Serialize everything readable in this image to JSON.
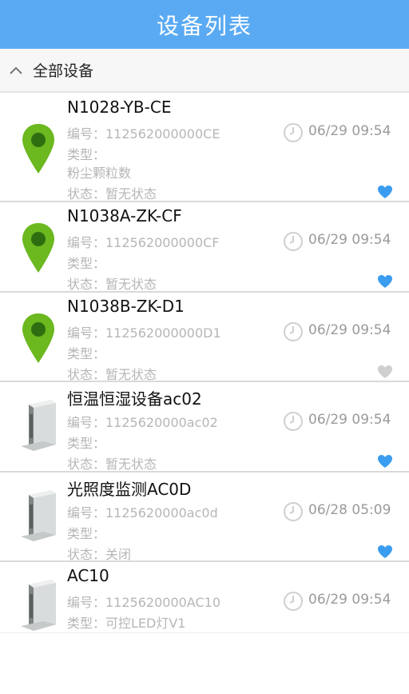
{
  "header": {
    "title": "设备列表"
  },
  "group": {
    "title": "全部设备"
  },
  "devices": [
    {
      "name": "N1028-YB-CE",
      "id_line": "编号：112562000000CE",
      "type_line": "类型：",
      "type_value": "粉尘颗粒数",
      "status_line": "状态：暂无状态",
      "time": "06/29 09:54",
      "icon": "map-pin-icon",
      "favorite": true
    },
    {
      "name": "N1038A-ZK-CF",
      "id_line": "编号：112562000000CF",
      "type_line": "类型：",
      "status_line": "状态：暂无状态",
      "time": "06/29 09:54",
      "icon": "map-pin-icon",
      "favorite": true
    },
    {
      "name": "N1038B-ZK-D1",
      "id_line": "编号：112562000000D1",
      "type_line": "类型：",
      "status_line": "状态：暂无状态",
      "time": "06/29 09:54",
      "icon": "map-pin-icon",
      "favorite": false
    },
    {
      "name": "恒温恒湿设备ac02",
      "id_line": "编号：1125620000ac02",
      "type_line": "类型：",
      "status_line": "状态：暂无状态",
      "time": "06/29 09:54",
      "icon": "device-box-icon",
      "favorite": true
    },
    {
      "name": "光照度监测AC0D",
      "id_line": "编号：1125620000ac0d",
      "type_line": "类型：",
      "status_line": "状态：关闭",
      "time": "06/28 05:09",
      "icon": "device-box-icon",
      "favorite": true
    },
    {
      "name": "AC10",
      "id_line": "编号：1125620000AC10",
      "type_line": "类型：可控LED灯V1",
      "time": "06/29 09:54",
      "icon": "device-box-icon"
    }
  ],
  "colors": {
    "header_bg": "#5aaaf3",
    "pin_green": "#6bb81f",
    "heart_blue": "#3b9df0",
    "heart_gray": "#cfcfcf"
  }
}
